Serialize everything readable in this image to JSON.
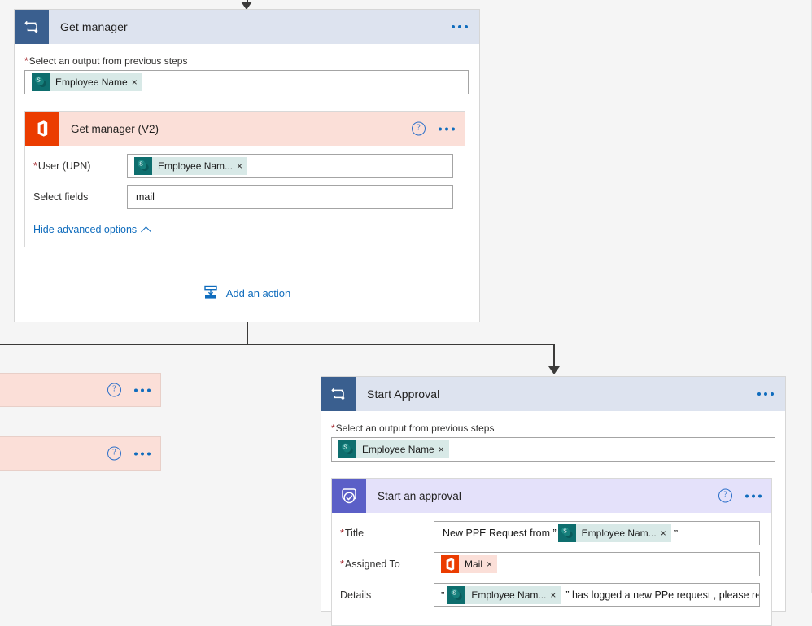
{
  "flow": {
    "scope_cards": [
      {
        "id": "get-manager",
        "title": "Get manager",
        "icon": "apply-to-each-icon",
        "output_selector": {
          "label": "Select an output from previous steps",
          "required": true,
          "token": {
            "text": "Employee Name",
            "icon": "sharepoint-icon",
            "remove": "×"
          }
        },
        "action": {
          "title": "Get manager (V2)",
          "icon": "office365-users-icon",
          "help": "?",
          "menu": "•••",
          "fields": [
            {
              "label": "User (UPN)",
              "required": true,
              "type": "token",
              "token": {
                "text": "Employee Nam...",
                "icon": "sharepoint-icon",
                "remove": "×"
              }
            },
            {
              "label": "Select fields",
              "required": false,
              "type": "text",
              "value": "mail"
            }
          ],
          "advanced_toggle": "Hide advanced options"
        },
        "add_action_label": "Add an action"
      },
      {
        "id": "start-approval",
        "title": "Start Approval",
        "icon": "apply-to-each-icon",
        "output_selector": {
          "label": "Select an output from previous steps",
          "required": true,
          "token": {
            "text": "Employee Name",
            "icon": "sharepoint-icon",
            "remove": "×"
          }
        },
        "action": {
          "title": "Start an approval",
          "icon": "approvals-icon",
          "help": "?",
          "menu": "•••",
          "fields": [
            {
              "label": "Title",
              "required": true,
              "type": "mixed",
              "prefix_text": "New PPE Request from ”",
              "token": {
                "text": "Employee Nam...",
                "icon": "sharepoint-icon",
                "remove": "×"
              },
              "suffix_text": "”"
            },
            {
              "label": "Assigned To",
              "required": true,
              "type": "token",
              "token": {
                "text": "Mail",
                "icon": "office365-users-icon",
                "remove": "×"
              }
            },
            {
              "label": "Details",
              "required": false,
              "type": "mixed",
              "prefix_text": "”",
              "token": {
                "text": "Employee Nam...",
                "icon": "sharepoint-icon",
                "remove": "×"
              },
              "suffix_text": "” has logged a new PPe request , please review"
            }
          ]
        }
      }
    ],
    "stub_cards": [
      {
        "id": "stub-1",
        "help": "?",
        "menu": "•••"
      },
      {
        "id": "stub-2",
        "help": "?",
        "menu": "•••"
      }
    ]
  },
  "colors": {
    "canvas": "#f5f5f5",
    "scope_header": "#dde3ef",
    "scope_icon": "#3a5f8f",
    "office_header": "#fbdfd8",
    "office_icon": "#eb3c00",
    "approval_header": "#e4e1fa",
    "approval_icon": "#5b5fc7",
    "sharepoint_icon": "#0e6e6e",
    "link": "#0f6cbd",
    "required": "#a4262c",
    "connector": "#3b3a39",
    "token_bg": "#d8e9e7",
    "token_bg_orange": "#fbdfd8"
  }
}
